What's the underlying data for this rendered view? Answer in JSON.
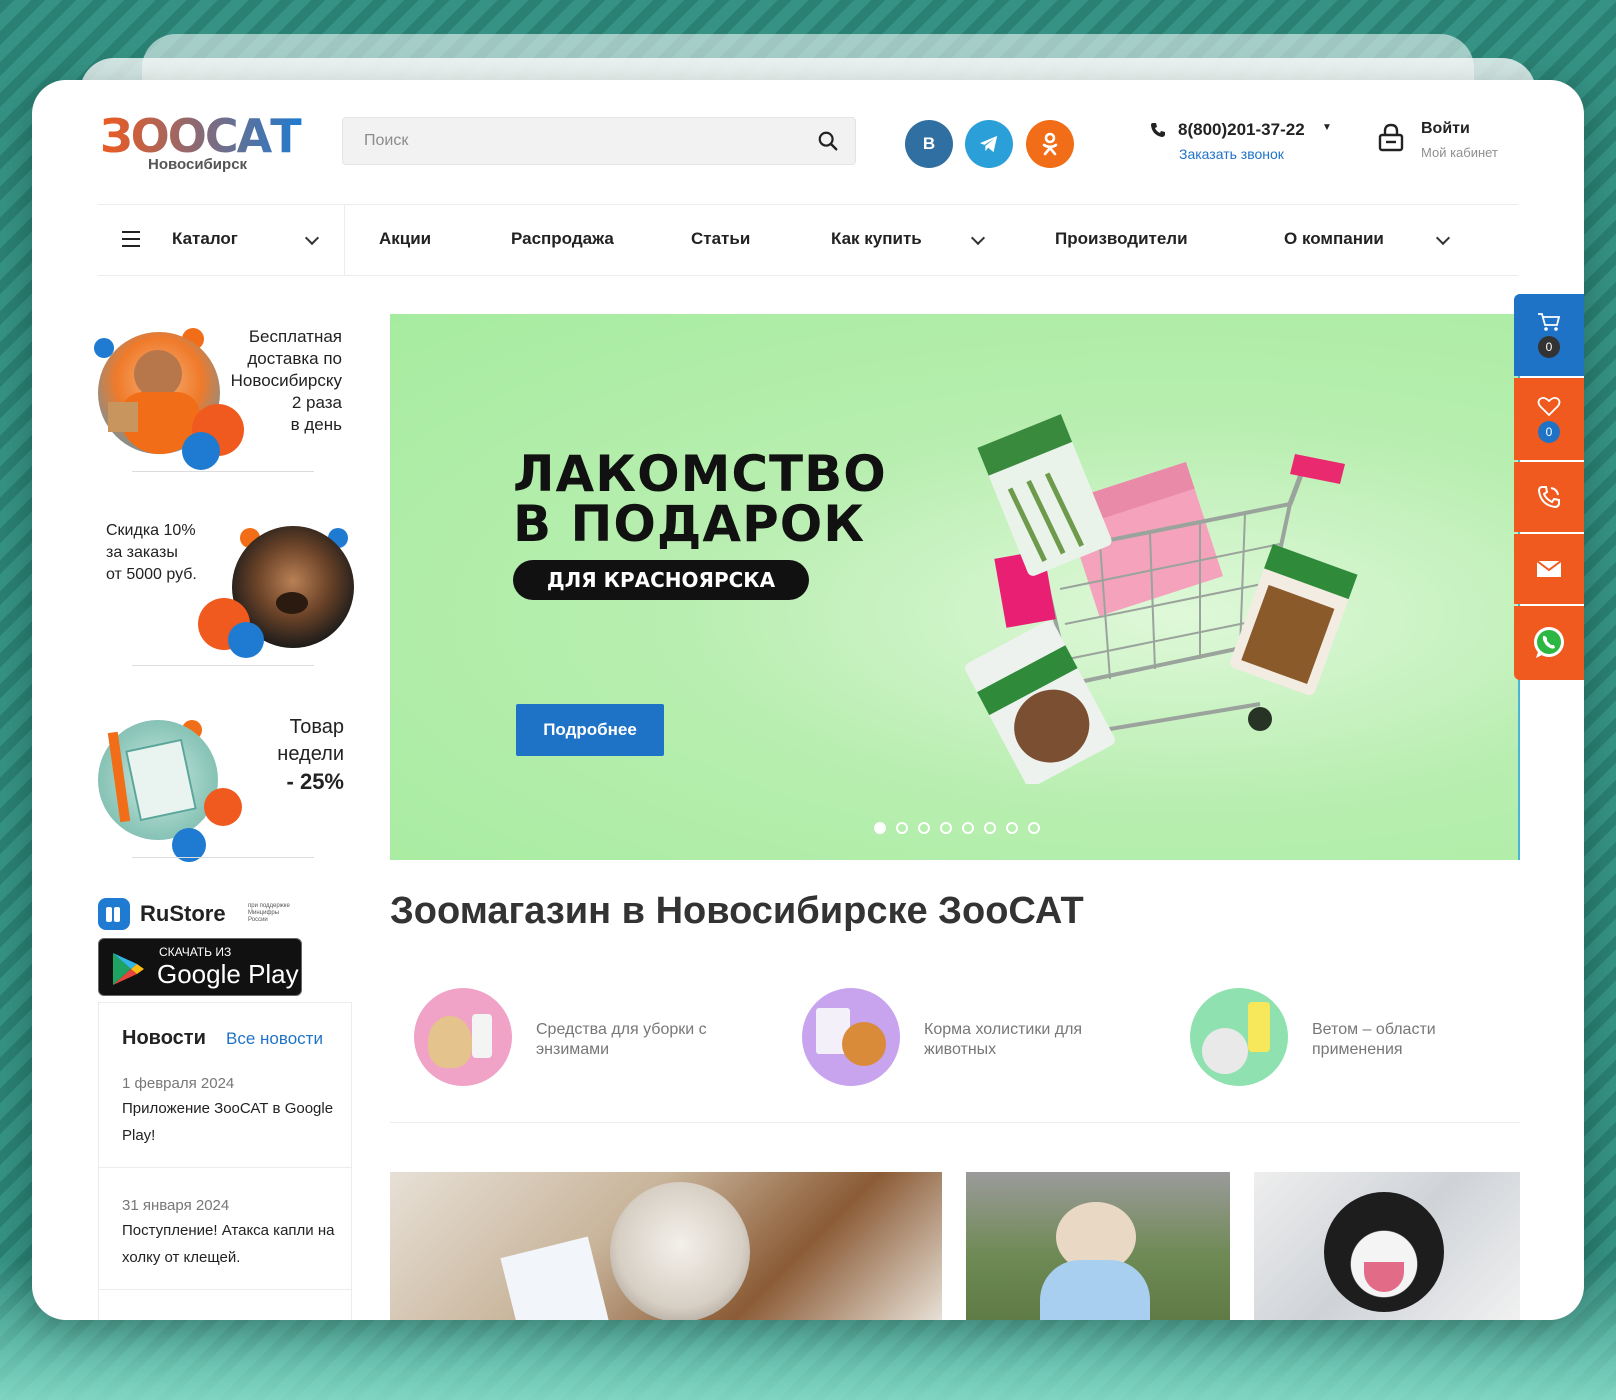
{
  "header": {
    "logo_text": "ЗООСАТ",
    "city": "Новосибирск",
    "search_placeholder": "Поиск",
    "social": [
      {
        "name": "vk",
        "label": "В"
      },
      {
        "name": "telegram",
        "label": ""
      },
      {
        "name": "odnoklassniki",
        "label": ""
      }
    ],
    "phone": "8(800)201-37-22",
    "callback": "Заказать звонок",
    "login": "Войти",
    "cabinet": "Мой кабинет"
  },
  "nav": {
    "catalog": "Каталог",
    "items": [
      "Акции",
      "Распродажа",
      "Статьи",
      "Как купить",
      "Производители",
      "О компании"
    ]
  },
  "sidebar": {
    "promo1": [
      "Бесплатная",
      "доставка по",
      "Новосибирску",
      "2 раза",
      "в день"
    ],
    "promo2": [
      "Скидка 10%",
      "за заказы",
      "от 5000 руб."
    ],
    "promo3": [
      "Товар",
      "недели",
      "- 25%"
    ],
    "rustore": "RuStore",
    "rustore_note": "при поддержке Минцифры России",
    "gplay_small": "СКАЧАТЬ ИЗ",
    "gplay_big": "Google Play"
  },
  "news": {
    "title": "Новости",
    "all": "Все новости",
    "items": [
      {
        "date": "1 февраля 2024",
        "text": "Приложение ЗооСАТ в Google Play!"
      },
      {
        "date": "31 января 2024",
        "text": "Поступление! Атакса капли на холку от клещей."
      }
    ]
  },
  "banner": {
    "title_line1": "ЛАКОМСТВО",
    "title_line2": "В ПОДАРОК",
    "pill": "ДЛЯ КРАСНОЯРСКА",
    "button": "Подробнее",
    "slides": 8,
    "active_slide": 1
  },
  "main": {
    "title": "Зоомагазин в Новосибирске ЗооСАТ",
    "categories": [
      {
        "label": "Средства для уборки с энзимами",
        "color": "#f0a3c6"
      },
      {
        "label": "Корма холистики для животных",
        "color": "#c8a3ee"
      },
      {
        "label": "Ветом – области применения",
        "color": "#8fe2b0"
      }
    ]
  },
  "right_bar": {
    "cart_count": "0",
    "fav_count": "0"
  },
  "colors": {
    "accent_blue": "#1f73c7",
    "accent_orange": "#f26d17",
    "banner_green": "#a6ec9f"
  }
}
